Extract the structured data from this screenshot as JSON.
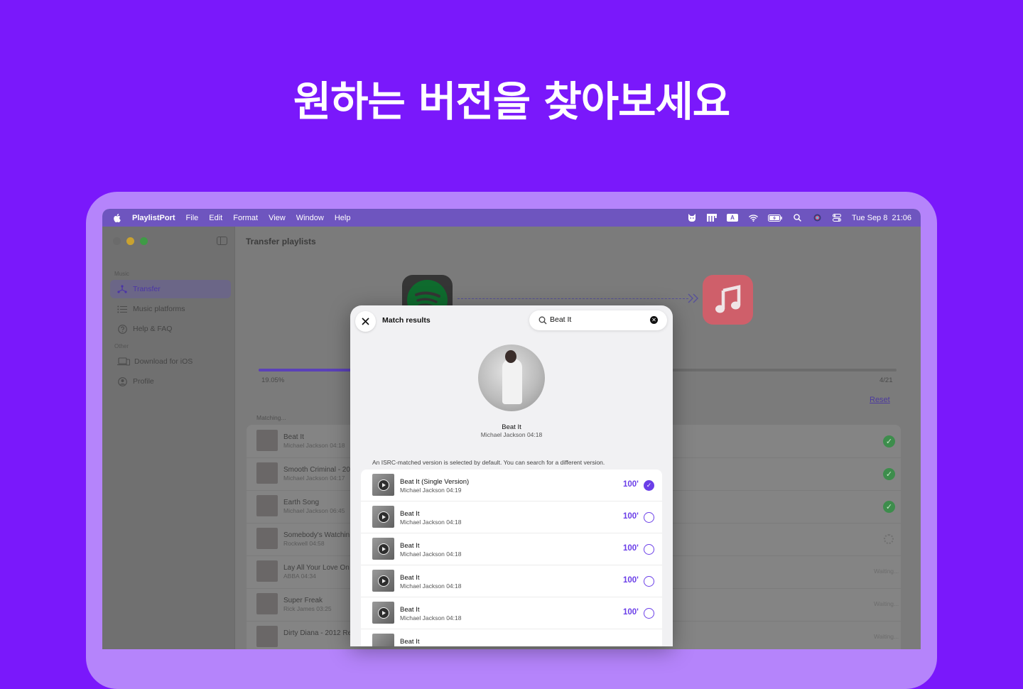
{
  "headline": "원하는 버전을 찾아보세요",
  "menubar": {
    "app_name": "PlaylistPort",
    "menus": [
      "File",
      "Edit",
      "Format",
      "View",
      "Window",
      "Help"
    ],
    "input_indicator": "A",
    "clock": "Tue Sep 8  21:06"
  },
  "sidebar": {
    "section_music": "Music",
    "section_other": "Other",
    "items": [
      {
        "label": "Transfer",
        "icon": "transfer-icon",
        "selected": true
      },
      {
        "label": "Music platforms",
        "icon": "list-icon",
        "selected": false
      },
      {
        "label": "Help & FAQ",
        "icon": "question-icon",
        "selected": false
      },
      {
        "label": "Download for iOS",
        "icon": "laptop-phone-icon",
        "selected": false
      },
      {
        "label": "Profile",
        "icon": "person-icon",
        "selected": false
      }
    ]
  },
  "main": {
    "title": "Transfer playlists",
    "progress": {
      "percent_label": "19.05%",
      "fraction": 0.1905,
      "count": "4/21"
    },
    "reset_label": "Reset",
    "matching_label": "Matching...",
    "tracks": [
      {
        "title": "Beat It",
        "meta": "Michael Jackson 04:18",
        "status": "done"
      },
      {
        "title": "Smooth Criminal - 20",
        "meta": "Michael Jackson 04:17",
        "status": "done"
      },
      {
        "title": "Earth Song",
        "meta": "Michael Jackson 06:45",
        "status": "done"
      },
      {
        "title": "Somebody's Watchin",
        "meta": "Rockwell 04:58",
        "status": "loading"
      },
      {
        "title": "Lay All Your Love On",
        "meta": "ABBA 04:34",
        "status": "waiting",
        "status_text": "Waiting..."
      },
      {
        "title": "Super Freak",
        "meta": "Rick James 03:25",
        "status": "waiting",
        "status_text": "Waiting..."
      },
      {
        "title": "Dirty Diana - 2012 Re",
        "meta": "",
        "status": "waiting",
        "status_text": "Waiting..."
      }
    ]
  },
  "modal": {
    "title": "Match results",
    "search": {
      "value": "Beat It",
      "placeholder": ""
    },
    "selected": {
      "title": "Beat It",
      "meta": "Michael Jackson 04:18"
    },
    "note": "An ISRC-matched version is selected by default. You can search for a different version.",
    "results": [
      {
        "title": "Beat It (Single Version)",
        "meta": "Michael Jackson 04:19",
        "score": "100'",
        "selected": true
      },
      {
        "title": "Beat It",
        "meta": "Michael Jackson 04:18",
        "score": "100'",
        "selected": false
      },
      {
        "title": "Beat It",
        "meta": "Michael Jackson 04:18",
        "score": "100'",
        "selected": false
      },
      {
        "title": "Beat It",
        "meta": "Michael Jackson 04:18",
        "score": "100'",
        "selected": false
      },
      {
        "title": "Beat It",
        "meta": "Michael Jackson 04:18",
        "score": "100'",
        "selected": false
      },
      {
        "title": "Beat It",
        "meta": "",
        "score": "",
        "selected": false
      }
    ]
  },
  "colors": {
    "background": "#7a18fb",
    "accent": "#6b3fe8",
    "success": "#3d8d4c"
  }
}
